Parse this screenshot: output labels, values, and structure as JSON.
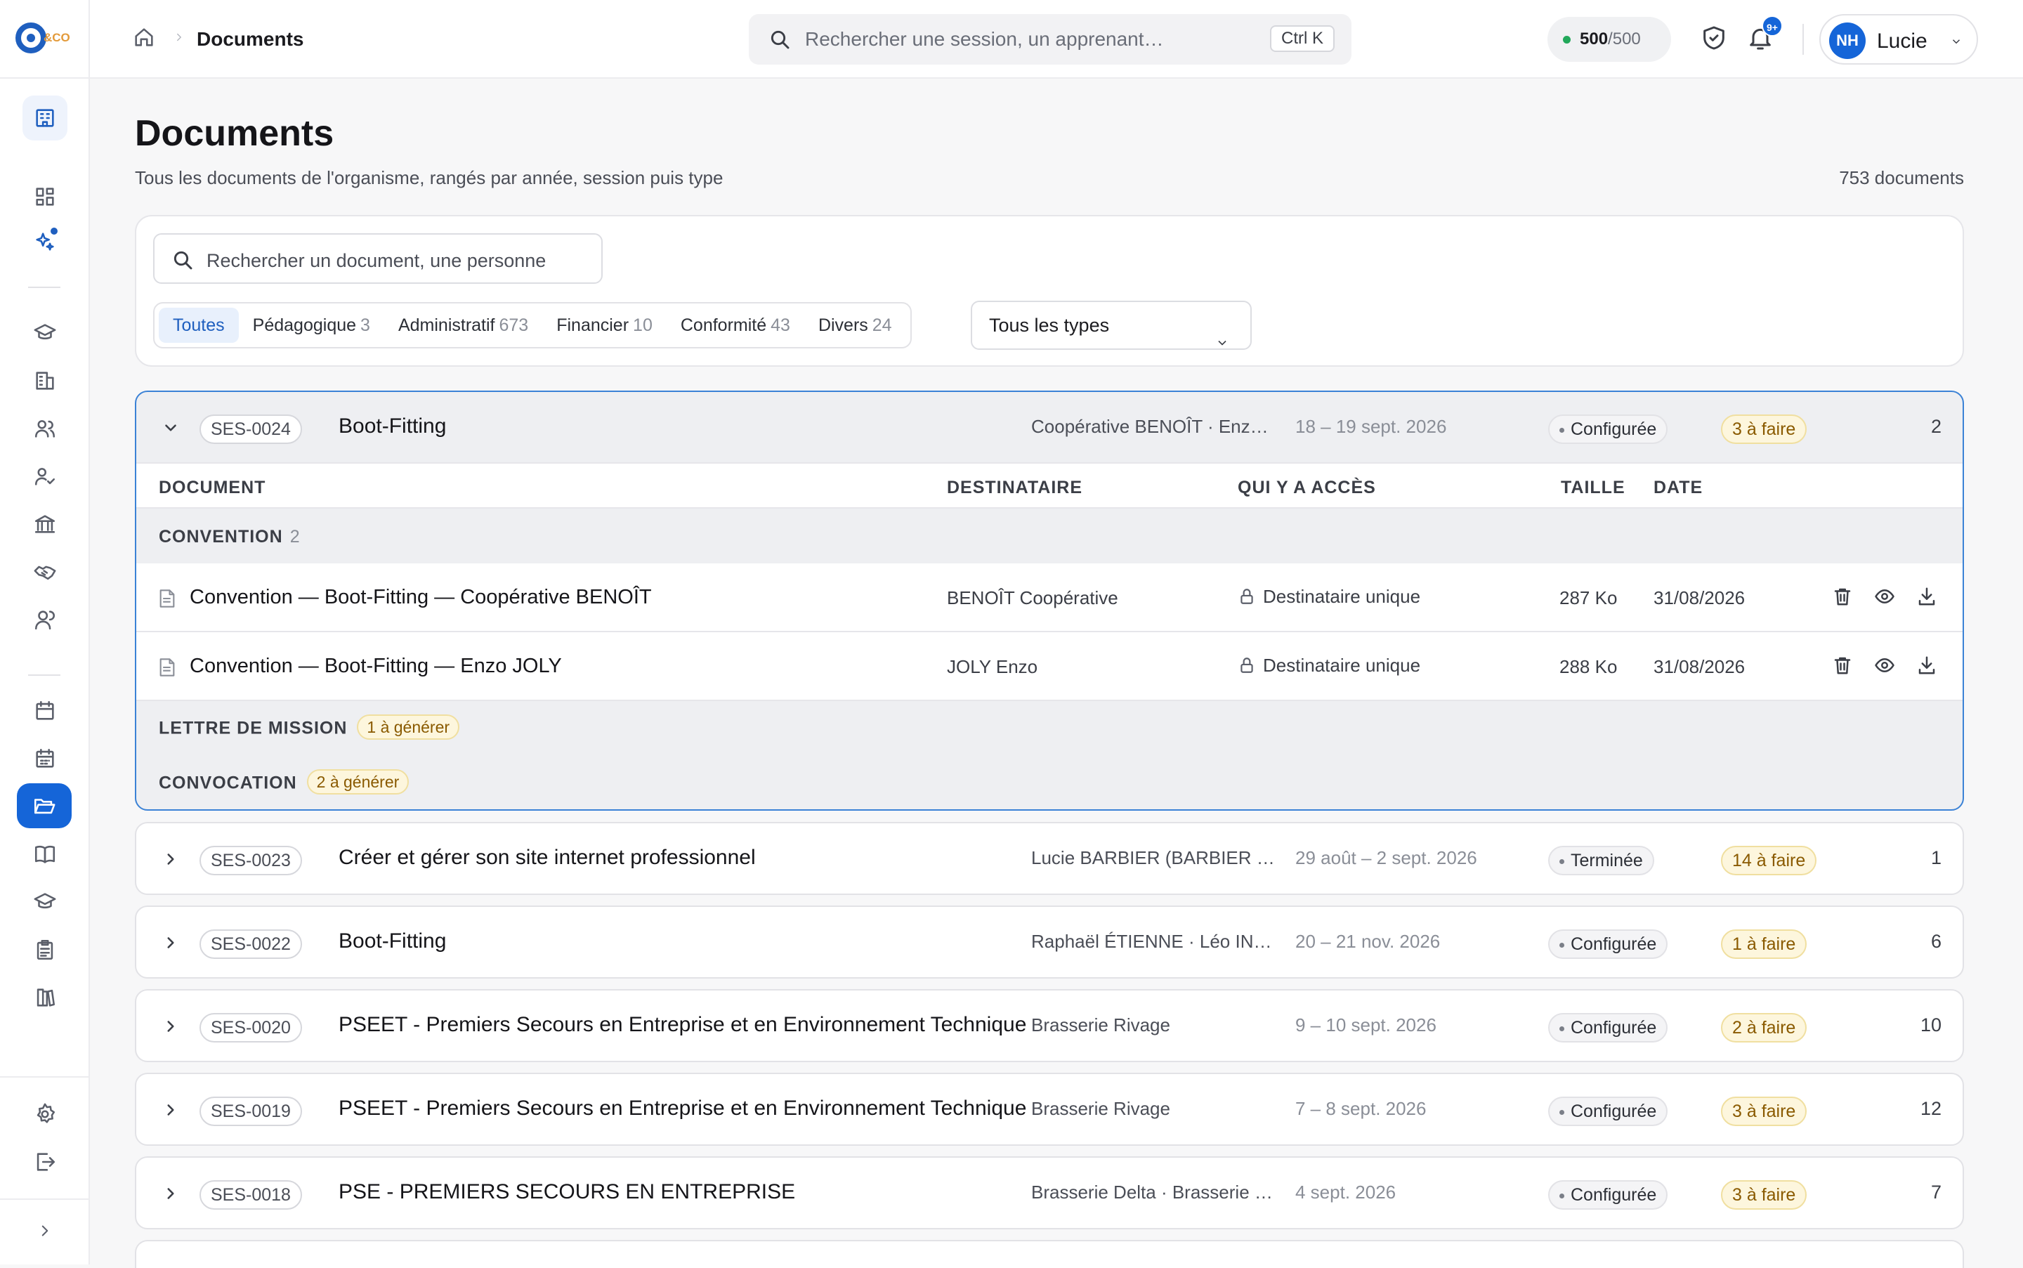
{
  "header": {
    "breadcrumb": "Documents",
    "search_placeholder": "Rechercher une session, un apprenant…",
    "shortcut": "Ctrl K",
    "credits_used": "500",
    "credits_sep": "/",
    "credits_total": "500",
    "notif_badge": "9+",
    "user_initials": "NH",
    "user_name": "Lucie"
  },
  "page": {
    "title": "Documents",
    "subtitle": "Tous les documents de l'organisme, rangés par année, session puis type",
    "count": "753 documents"
  },
  "filters": {
    "search_placeholder": "Rechercher un document, une personne",
    "categories": [
      {
        "label": "Toutes",
        "count": ""
      },
      {
        "label": "Pédagogique",
        "count": "3"
      },
      {
        "label": "Administratif",
        "count": "673"
      },
      {
        "label": "Financier",
        "count": "10"
      },
      {
        "label": "Conformité",
        "count": "43"
      },
      {
        "label": "Divers",
        "count": "24"
      }
    ],
    "type_select": "Tous les types"
  },
  "table_headers": {
    "document": "DOCUMENT",
    "recipient": "DESTINATAIRE",
    "access": "QUI Y A ACCÈS",
    "size": "TAILLE",
    "date": "DATE"
  },
  "open_session": {
    "code": "SES-0024",
    "name": "Boot-Fitting",
    "client": "Coopérative BENOÎT · Enzo JOLY",
    "dates": "18 – 19 sept. 2026",
    "status": "Configurée",
    "todo": "3 à faire",
    "count": "2",
    "groups": [
      {
        "label": "CONVENTION",
        "count": "2"
      },
      {
        "label": "LETTRE DE MISSION",
        "badge": "1 à générer"
      },
      {
        "label": "CONVOCATION",
        "badge": "2 à générer"
      }
    ],
    "documents": [
      {
        "name": "Convention — Boot-Fitting — Coopérative BENOÎT",
        "recipient": "BENOÎT Coopérative",
        "access": "Destinataire unique",
        "size": "287 Ko",
        "date": "31/08/2026"
      },
      {
        "name": "Convention — Boot-Fitting — Enzo JOLY",
        "recipient": "JOLY Enzo",
        "access": "Destinataire unique",
        "size": "288 Ko",
        "date": "31/08/2026"
      }
    ]
  },
  "sessions": [
    {
      "code": "SES-0023",
      "name": "Créer et gérer son site internet professionnel",
      "client": "Lucie BARBIER (BARBIER Développement)",
      "dates": "29 août – 2 sept. 2026",
      "status": "Terminée",
      "todo": "14 à faire",
      "count": "1"
    },
    {
      "code": "SES-0022",
      "name": "Boot-Fitting",
      "client": "Raphaël ÉTIENNE · Léo INÈS",
      "dates": "20 – 21 nov. 2026",
      "status": "Configurée",
      "todo": "1 à faire",
      "count": "6"
    },
    {
      "code": "SES-0020",
      "name": "PSEET - Premiers Secours en Entreprise et en Environnement Technique",
      "client": "Brasserie Rivage",
      "dates": "9 – 10 sept. 2026",
      "status": "Configurée",
      "todo": "2 à faire",
      "count": "10"
    },
    {
      "code": "SES-0019",
      "name": "PSEET - Premiers Secours en Entreprise et en Environnement Technique",
      "client": "Brasserie Rivage",
      "dates": "7 – 8 sept. 2026",
      "status": "Configurée",
      "todo": "3 à faire",
      "count": "12"
    },
    {
      "code": "SES-0018",
      "name": "PSE - PREMIERS SECOURS EN ENTREPRISE",
      "client": "Brasserie Delta · Brasserie Rivage",
      "dates": "4 sept. 2026",
      "status": "Configurée",
      "todo": "3 à faire",
      "count": "7"
    }
  ],
  "icons": {
    "sidebar": [
      "building-icon",
      "dashboard-icon",
      "sparkles-icon",
      "graduation-icon",
      "building-icon",
      "users-icon",
      "user-check-icon",
      "bank-icon",
      "handshake-icon",
      "team-icon",
      "calendar-icon",
      "calendar-grid-icon",
      "folder-open-icon",
      "book-icon",
      "graduation-icon",
      "clipboard-icon",
      "library-icon",
      "settings-icon",
      "logout-icon",
      "chevron-right-icon"
    ],
    "accent": "#1565d8"
  }
}
